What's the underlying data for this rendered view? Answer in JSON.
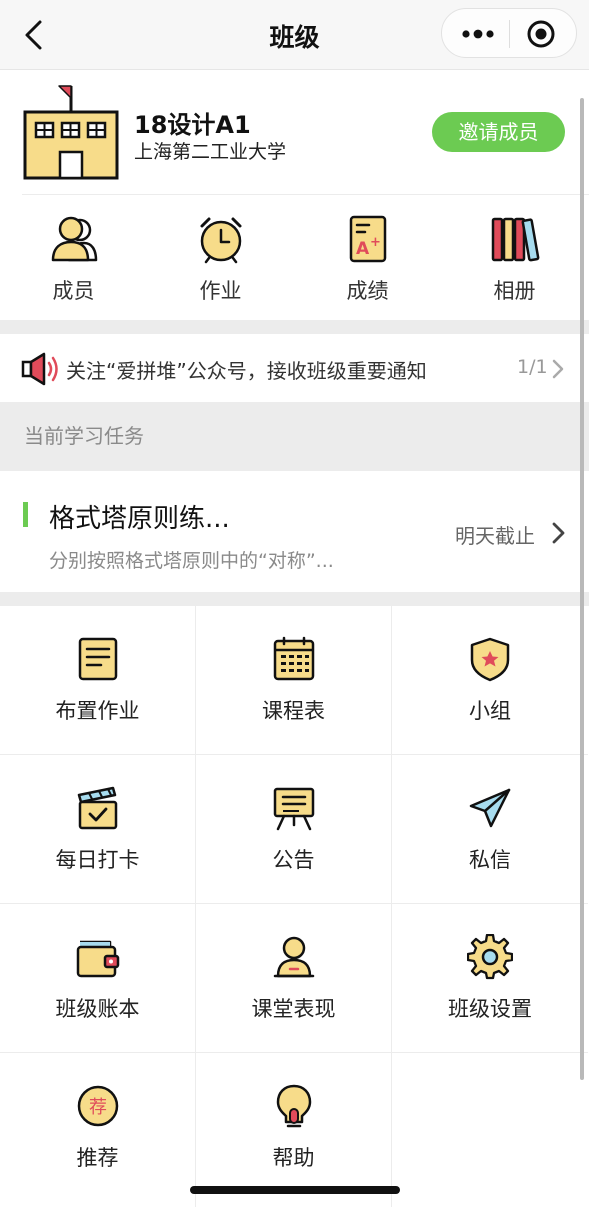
{
  "nav": {
    "title": "班级",
    "back_icon": "chevron-left-icon",
    "more_icon": "more-dots-icon",
    "close_icon": "target-circle-icon"
  },
  "class_info": {
    "name": "18设计A1",
    "school": "上海第二工业大学",
    "invite_label": "邀请成员",
    "logo_icon": "school-building-icon"
  },
  "quick_nav": [
    {
      "label": "成员",
      "icon": "members-icon"
    },
    {
      "label": "作业",
      "icon": "alarm-clock-icon"
    },
    {
      "label": "成绩",
      "icon": "grade-a-plus-icon"
    },
    {
      "label": "相册",
      "icon": "books-album-icon"
    }
  ],
  "notice": {
    "text": "关注“爱拼堆”公众号，接收班级重要通知",
    "page": "1/1",
    "icon": "speaker-icon"
  },
  "current_tasks": {
    "section_title": "当前学习任务",
    "items": [
      {
        "title": "格式塔原则练...",
        "description": "分别按照格式塔原则中的“对称”...",
        "due": "明天截止"
      }
    ]
  },
  "features": [
    {
      "label": "布置作业",
      "icon": "assignment-note-icon"
    },
    {
      "label": "课程表",
      "icon": "timetable-calendar-icon"
    },
    {
      "label": "小组",
      "icon": "group-shield-star-icon"
    },
    {
      "label": "每日打卡",
      "icon": "daily-checkin-icon"
    },
    {
      "label": "公告",
      "icon": "announcement-board-icon"
    },
    {
      "label": "私信",
      "icon": "paper-plane-icon"
    },
    {
      "label": "班级账本",
      "icon": "wallet-icon"
    },
    {
      "label": "课堂表现",
      "icon": "user-performance-icon"
    },
    {
      "label": "班级设置",
      "icon": "gear-icon"
    },
    {
      "label": "推荐",
      "icon": "recommend-badge-icon",
      "badge": "荐"
    },
    {
      "label": "帮助",
      "icon": "lightbulb-icon"
    }
  ],
  "colors": {
    "accent_green": "#6ccb52",
    "icon_yellow": "#f7dc8a",
    "icon_red": "#e04b5a",
    "divider": "#ececec"
  }
}
